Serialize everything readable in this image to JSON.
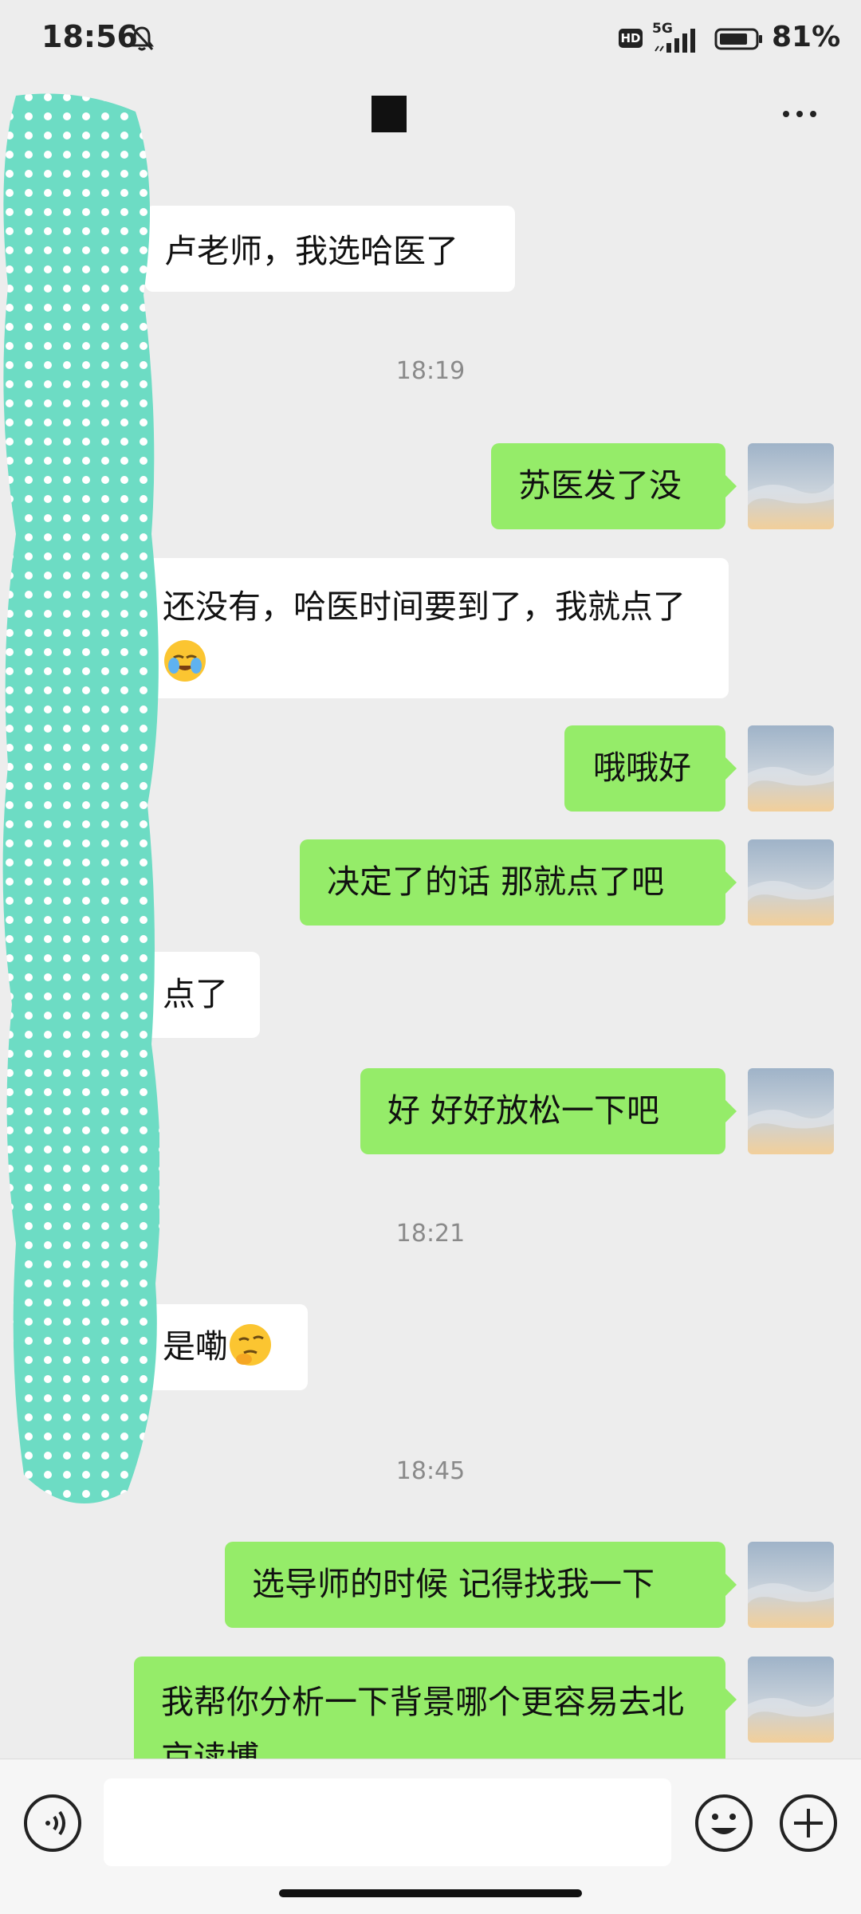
{
  "status_bar": {
    "time": "18:56",
    "network": "5G",
    "hd_badge": "HD",
    "battery_percent": "81%",
    "battery_level": 0.81,
    "icons": [
      "bell-muted-icon",
      "hd-icon",
      "signal-icon",
      "battery-icon"
    ]
  },
  "nav": {
    "more_icon": "more-dots-icon"
  },
  "messages": [
    {
      "side": "left",
      "text": "卢老师，我选哈医了"
    },
    {
      "type": "time",
      "text": "18:19"
    },
    {
      "side": "right",
      "text": "苏医发了没"
    },
    {
      "side": "left",
      "text": "还没有，哈医时间要到了，我就点了",
      "emoji": "face-palm-emoji"
    },
    {
      "side": "right",
      "text": "哦哦好"
    },
    {
      "side": "right",
      "text": "决定了的话 那就点了吧"
    },
    {
      "side": "left",
      "text": "点了"
    },
    {
      "side": "right",
      "text": "好 好好放松一下吧"
    },
    {
      "type": "time",
      "text": "18:21"
    },
    {
      "side": "left",
      "text": "是嘞",
      "emoji": "thinking-face-emoji"
    },
    {
      "type": "time",
      "text": "18:45"
    },
    {
      "side": "right",
      "text": "选导师的时候 记得找我一下"
    },
    {
      "side": "right",
      "text": "我帮你分析一下背景哪个更容易去北京读博"
    }
  ],
  "input_bar": {
    "value": "",
    "icons": [
      "voice-icon",
      "emoji-icon",
      "plus-icon"
    ]
  },
  "colors": {
    "background": "#ededed",
    "sent_bubble": "#95ec69",
    "received_bubble": "#ffffff",
    "censor_blob": "#6ddcc4"
  }
}
